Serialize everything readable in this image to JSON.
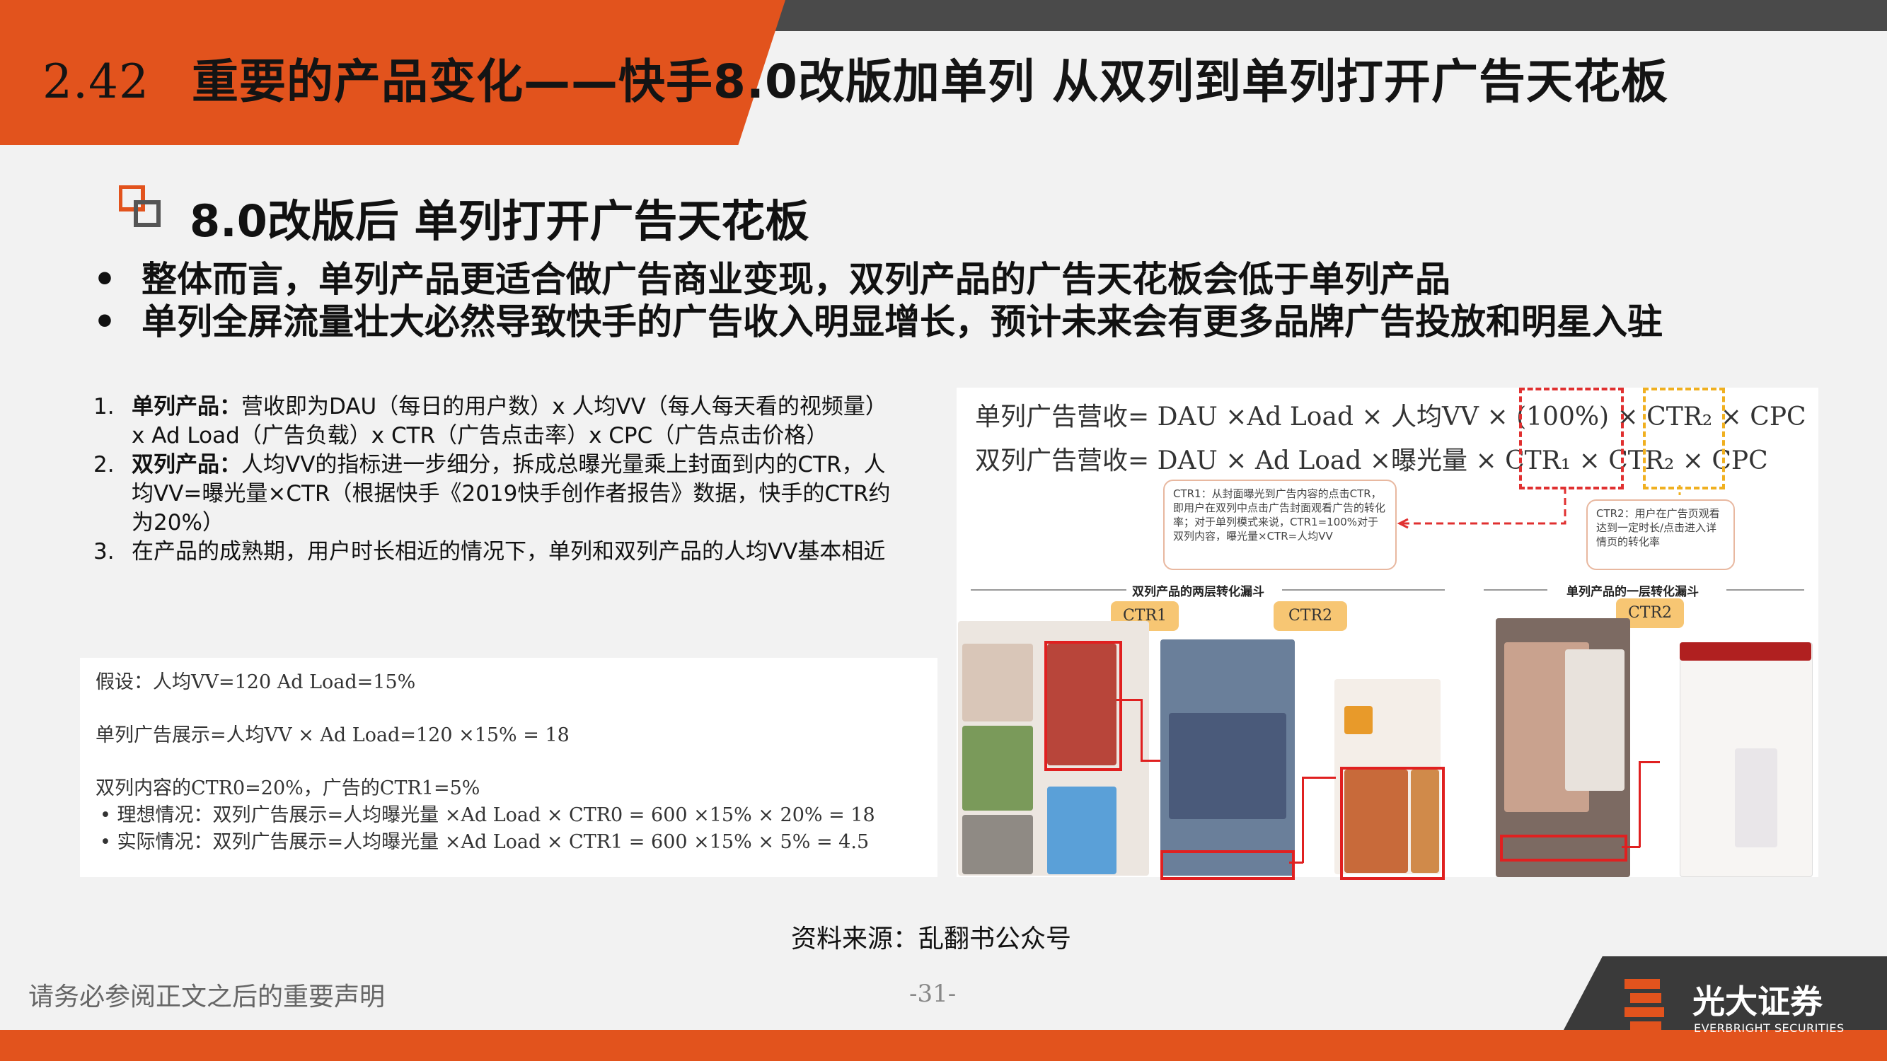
{
  "header": {
    "number": "2.42",
    "title": "重要的产品变化——快手8.0改版加单列 从双列到单列打开广告天花板"
  },
  "section": {
    "title": "8.0改版后 单列打开广告天花板"
  },
  "bullets": [
    "整体而言，单列产品更适合做广告商业变现，双列产品的广告天花板会低于单列产品",
    "单列全屏流量壮大必然导致快手的广告收入明显增长，预计未来会有更多品牌广告投放和明星入驻"
  ],
  "numbered": [
    {
      "n": "1.",
      "bold": "单列产品：",
      "text": "营收即为DAU（每日的用户数）x 人均VV（每人每天看的视频量）x Ad Load（广告负载）x CTR（广告点击率）x CPC（广告点击价格）"
    },
    {
      "n": "2.",
      "bold": "双列产品：",
      "text": "人均VV的指标进一步细分，拆成总曝光量乘上封面到内的CTR，人均VV=曝光量×CTR（根据快手《2019快手创作者报告》数据，快手的CTR约为20%）"
    },
    {
      "n": "3.",
      "bold": "",
      "text": "在产品的成熟期，用户时长相近的情况下，单列和双列产品的人均VV基本相近"
    }
  ],
  "assumption": {
    "line1": "假设：人均VV=120 Ad Load=15%",
    "line2": "单列广告展示=人均VV × Ad Load=120 ×15% = 18",
    "line3": "双列内容的CTR0=20%，广告的CTR1=5%",
    "line4": "•   理想情况：双列广告展示=人均曝光量 ×Ad Load × CTR0 = 600 ×15% × 20% = 18",
    "line5": "•   实际情况：双列广告展示=人均曝光量 ×Ad Load × CTR1 = 600 ×15% × 5% = 4.5"
  },
  "diagram": {
    "formula1": "单列广告营收= DAU ×Ad Load × 人均VV × (100%) × CTR₂ × CPC",
    "formula2": "双列广告营收= DAU × Ad Load ×曝光量 × CTR₁ × CTR₂ × CPC",
    "note1": "CTR1：从封面曝光到广告内容的点击CTR，即用户在双列中点击广告封面观看广告的转化率；对于单列模式来说，CTR1=100%对于双列内容，曝光量×CTR=人均VV",
    "note2": "CTR2：用户在广告页观看达到一定时长/点击进入详情页的转化率",
    "caption_left": "双列产品的两层转化漏斗",
    "caption_right": "单列产品的一层转化漏斗",
    "tag_ctr1": "CTR1",
    "tag_ctr2a": "CTR2",
    "tag_ctr2b": "CTR2"
  },
  "source": "资料来源：乱翻书公众号",
  "footer": {
    "disclaimer": "请务必参阅正文之后的重要声明",
    "page": "-31-",
    "logo_cn": "光大证券",
    "logo_en": "EVERBRIGHT SECURITIES"
  }
}
